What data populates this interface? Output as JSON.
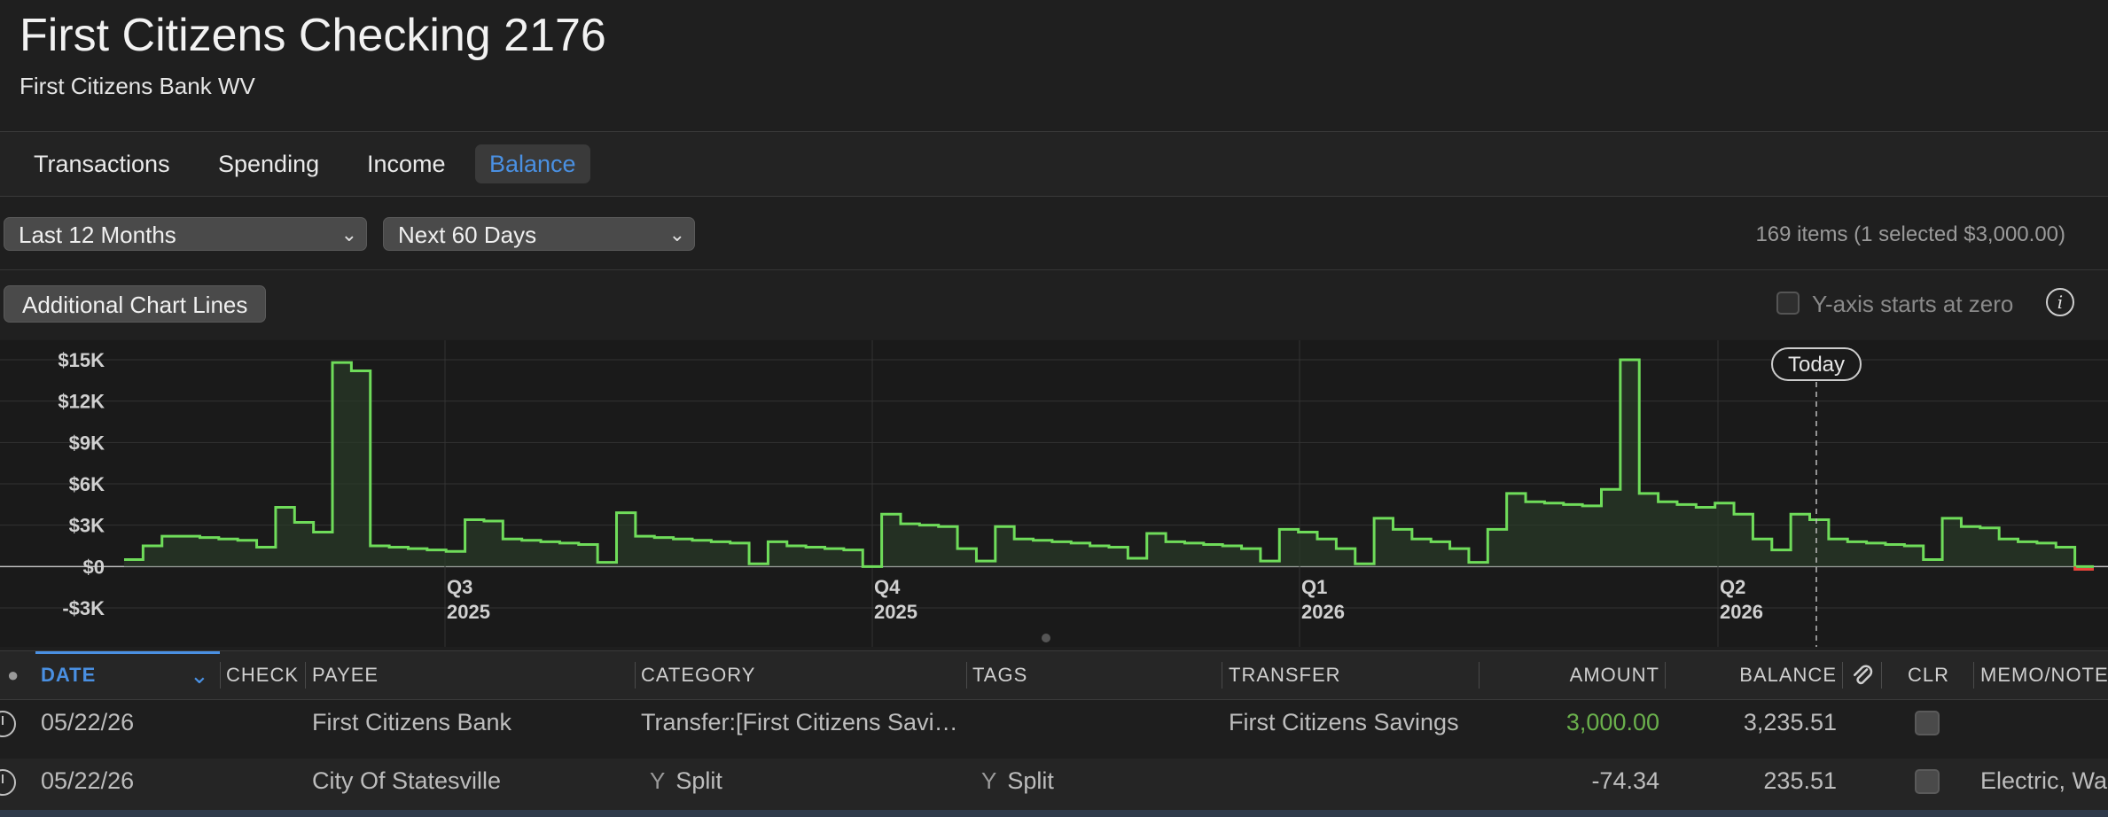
{
  "account": {
    "title": "First Citizens Checking 2176",
    "subtitle": "First Citizens Bank WV"
  },
  "tabs": [
    {
      "label": "Transactions",
      "active": false
    },
    {
      "label": "Spending",
      "active": false
    },
    {
      "label": "Income",
      "active": false
    },
    {
      "label": "Balance",
      "active": true
    }
  ],
  "filters": {
    "range": "Last 12 Months",
    "forecast": "Next 60 Days",
    "count_text": "169 items (1 selected $3,000.00)"
  },
  "toolbar": {
    "additional_lines_label": "Additional Chart Lines",
    "y_axis_zero_label": "Y-axis starts at zero",
    "y_axis_zero_checked": false
  },
  "chart_data": {
    "type": "line",
    "y_ticks": [
      "$15K",
      "$12K",
      "$9K",
      "$6K",
      "$3K",
      "$0",
      "-$3K"
    ],
    "ylim": [
      -3000,
      15000
    ],
    "x_ticks": [
      {
        "q": "Q3",
        "y": "2025"
      },
      {
        "q": "Q4",
        "y": "2025"
      },
      {
        "q": "Q1",
        "y": "2026"
      },
      {
        "q": "Q2",
        "y": "2026"
      }
    ],
    "today_label": "Today",
    "colors": {
      "line": "#6fdc5a",
      "fill": "#2a3a28",
      "negative": "#e8443a",
      "grid": "#333333",
      "zero": "#bdbdbd"
    },
    "series": [
      {
        "values": [
          500,
          1500,
          2200,
          2200,
          2100,
          2000,
          1900,
          1400,
          4300,
          3200,
          2500,
          14800,
          14200,
          1500,
          1400,
          1300,
          1200,
          1100,
          3400,
          3300,
          2000,
          1900,
          1800,
          1700,
          1600,
          300,
          3900,
          2200,
          2100,
          2000,
          1900,
          1800,
          1700,
          200,
          1800,
          1500,
          1400,
          1300,
          1200,
          0,
          3800,
          3100,
          3000,
          2900,
          1300,
          400,
          2900,
          2000,
          1900,
          1800,
          1700,
          1500,
          1400,
          600,
          2400,
          1800,
          1700,
          1600,
          1500,
          1300,
          400,
          2700,
          2500,
          2000,
          1300,
          200,
          3500,
          2700,
          2000,
          1800,
          1300,
          300,
          2700,
          5300,
          4700,
          4600,
          4500,
          4400,
          5600,
          15000,
          5300,
          4700,
          4500,
          4300,
          4600,
          3800,
          2000,
          1200,
          3800,
          3400,
          2000,
          1800,
          1700,
          1600,
          1500,
          500,
          3500,
          2900,
          2800,
          2000,
          1800,
          1700,
          1400,
          -200
        ]
      }
    ]
  },
  "table": {
    "columns": {
      "date": "DATE",
      "check": "CHECK",
      "payee": "PAYEE",
      "category": "CATEGORY",
      "tags": "TAGS",
      "transfer": "TRANSFER",
      "amount": "AMOUNT",
      "balance": "BALANCE",
      "clr": "CLR",
      "memo": "MEMO/NOTE"
    },
    "rows": [
      {
        "date": "05/22/26",
        "payee": "First Citizens Bank",
        "category": "Transfer:[First Citizens Savi…",
        "tags": "",
        "transfer": "First Citizens Savings",
        "amount": "3,000.00",
        "balance": "3,235.51",
        "memo": ""
      },
      {
        "date": "05/22/26",
        "payee": "City Of Statesville",
        "category": "Split",
        "tags": "Split",
        "transfer": "",
        "amount": "-74.34",
        "balance": "235.51",
        "memo": "Electric, Wa"
      }
    ]
  }
}
